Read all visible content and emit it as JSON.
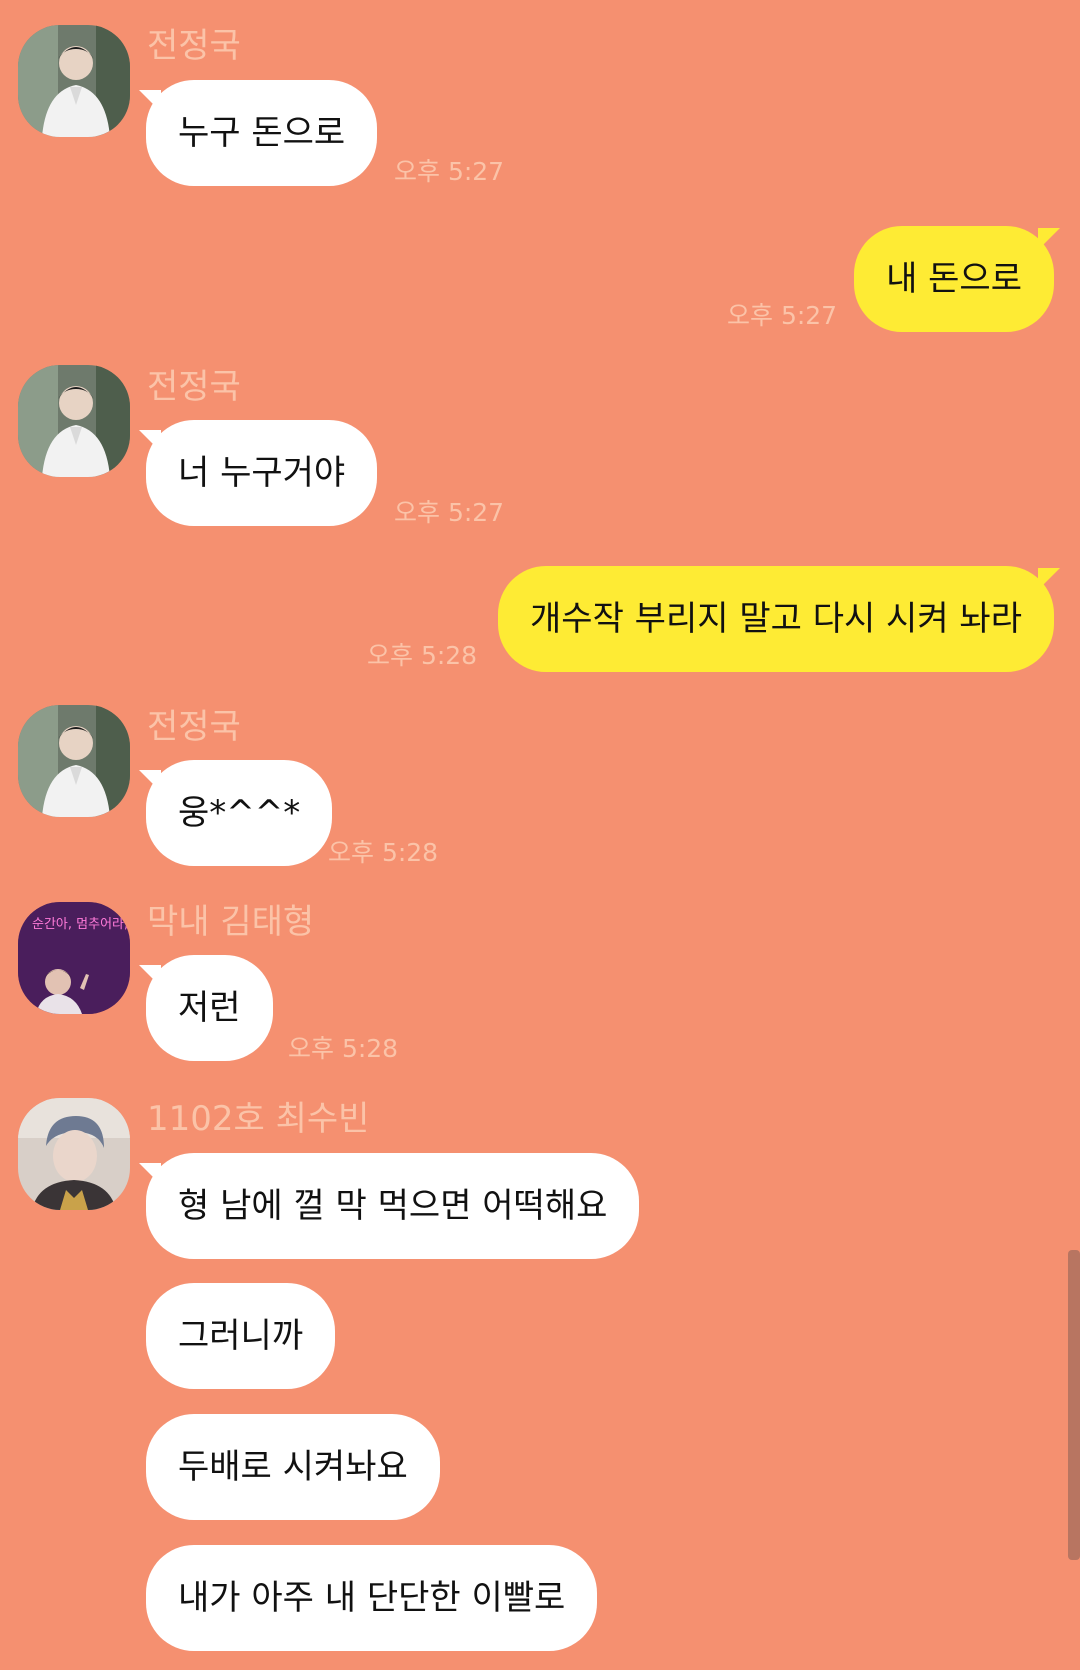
{
  "colors": {
    "background": "#F59070",
    "incoming_bubble": "#FFFFFF",
    "outgoing_bubble": "#FEEB34",
    "meta_text": "#FBC3A8",
    "scrollbar": "#B87561"
  },
  "messages": [
    {
      "sender": "전정국",
      "text": "누구 돈으로",
      "time": "오후 5:27"
    },
    {
      "text": "내 돈으로",
      "time": "오후 5:27"
    },
    {
      "sender": "전정국",
      "text": "너 누구거야",
      "time": "오후 5:27"
    },
    {
      "text": "개수작 부리지 말고 다시 시켜 놔라",
      "time": "오후 5:28"
    },
    {
      "sender": "전정국",
      "text": "웅*^^*",
      "time": "오후 5:28"
    },
    {
      "sender": "막내 김태형",
      "text": "저런",
      "time": "오후 5:28"
    },
    {
      "sender": "1102호 최수빈",
      "text": "형 남에 껄 막 먹으면 어떡해요"
    },
    {
      "text": "그러니까"
    },
    {
      "text": "두배로 시켜놔요"
    },
    {
      "text": "내가 아주 내 단단한 이빨로"
    }
  ],
  "avatar_neon_text": "순간아, 멈추어라, 너 정말 아름답구"
}
